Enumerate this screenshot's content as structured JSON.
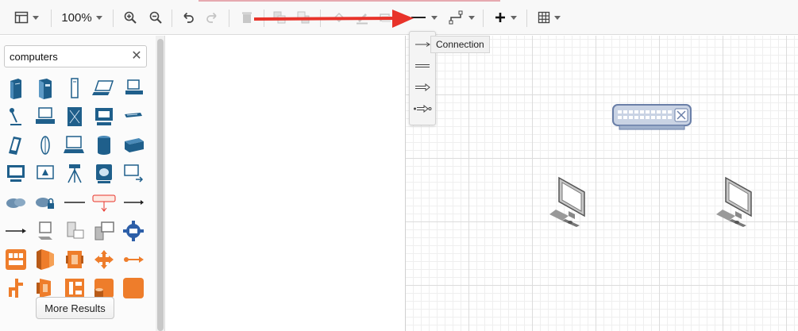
{
  "toolbar": {
    "zoom_label": "100%",
    "tools": [
      {
        "name": "format-panel-icon"
      },
      {
        "name": "zoom-in-icon"
      },
      {
        "name": "zoom-out-icon"
      },
      {
        "name": "undo-icon"
      },
      {
        "name": "redo-icon"
      },
      {
        "name": "delete-icon"
      },
      {
        "name": "to-front-icon"
      },
      {
        "name": "to-back-icon"
      },
      {
        "name": "fill-color-icon"
      },
      {
        "name": "line-color-icon"
      },
      {
        "name": "shadow-icon"
      },
      {
        "name": "connection-style-icon"
      },
      {
        "name": "waypoints-icon"
      },
      {
        "name": "insert-plus-icon"
      },
      {
        "name": "table-icon"
      }
    ]
  },
  "sidebar": {
    "search_value": "computers",
    "clear_label": "✕",
    "more_results_label": "More Results"
  },
  "connection_menu": {
    "tooltip": "Connection",
    "items": [
      "line",
      "link",
      "arrow",
      "simple-arrow"
    ]
  },
  "colors": {
    "accent_orange": "#ee7d2b",
    "network_blue": "#1f5f8b",
    "annotation_red": "#e8332a"
  }
}
